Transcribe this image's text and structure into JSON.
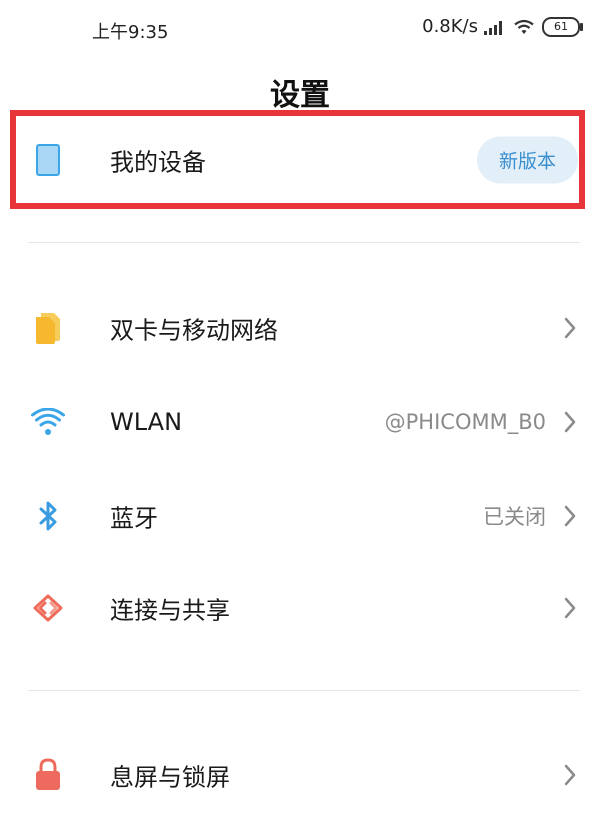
{
  "status_bar": {
    "time": "上午9:35",
    "network_speed": "0.8K/s",
    "battery": "61"
  },
  "page": {
    "title": "设置"
  },
  "my_device": {
    "label": "我的设备",
    "badge": "新版本",
    "icon": "phone-icon"
  },
  "connectivity": [
    {
      "label": "双卡与移动网络",
      "value": "",
      "icon": "sim-card-icon"
    },
    {
      "label": "WLAN",
      "value": "@PHICOMM_B0",
      "icon": "wifi-icon"
    },
    {
      "label": "蓝牙",
      "value": "已关闭",
      "icon": "bluetooth-icon"
    },
    {
      "label": "连接与共享",
      "value": "",
      "icon": "share-icon"
    }
  ],
  "lock": {
    "label": "息屏与锁屏",
    "value": "",
    "icon": "lock-icon"
  },
  "colors": {
    "accent": "#3a8fd0",
    "highlight_border": "#e8353a",
    "sim_yellow": "#f5b82e",
    "wifi_blue": "#3aa6e8",
    "share_red": "#ef6b5a",
    "lock_red": "#ee6a5e"
  }
}
